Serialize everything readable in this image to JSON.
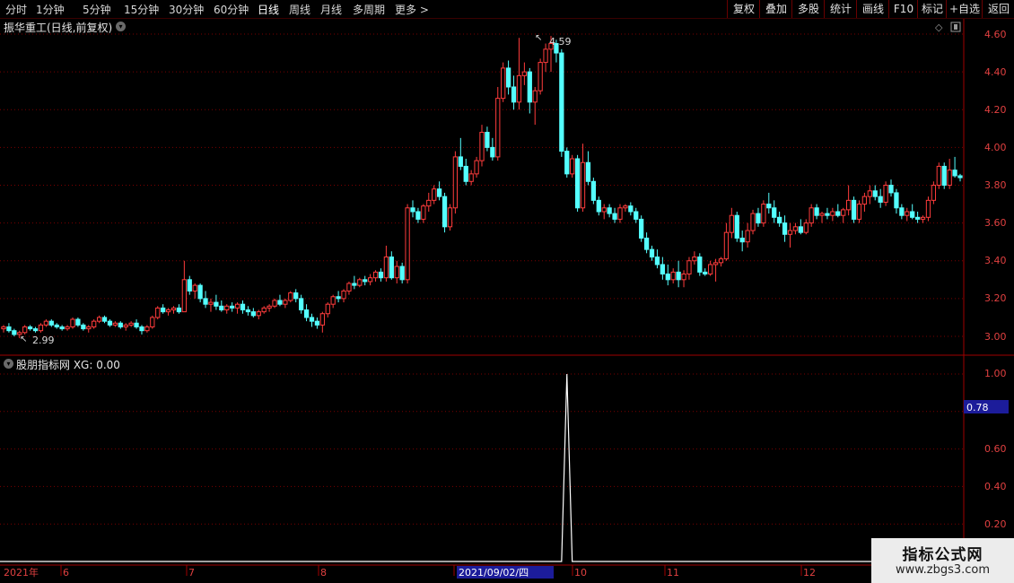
{
  "toolbar": {
    "periods": [
      "分时",
      "1分钟",
      "5分钟",
      "15分钟",
      "30分钟",
      "60分钟",
      "日线",
      "周线",
      "月线",
      "多周期",
      "更多 >"
    ],
    "active_period": "日线",
    "right_buttons": [
      "复权",
      "叠加",
      "多股",
      "统计",
      "画线",
      "F10",
      "标记",
      "+自选",
      "返回"
    ]
  },
  "main_chart": {
    "title": "振华重工(日线,前复权)",
    "price_ticks": [
      "4.60",
      "4.40",
      "4.20",
      "4.00",
      "3.80",
      "3.60",
      "3.40",
      "3.20",
      "3.00"
    ],
    "high_label": "4.59",
    "low_label": "2.99"
  },
  "indicator": {
    "title": "股朋指标网 XG: 0.00",
    "ticks": [
      "1.00",
      "0.80",
      "0.60",
      "0.40",
      "0.20"
    ],
    "cursor_value": "0.78"
  },
  "time_axis": {
    "labels": [
      "2021年",
      "6",
      "7",
      "8",
      "9",
      "10",
      "11",
      "12"
    ],
    "cursor_date": "2021/09/02/四"
  },
  "watermark": {
    "title": "指标公式网",
    "url": "www.zbgs3.com"
  },
  "colors": {
    "up": "#ff3c3c",
    "down": "#54ffff",
    "grid": "#7a0000",
    "axis": "#a00000"
  },
  "chart_data": {
    "type": "candlestick",
    "price_range": [
      2.95,
      4.65
    ],
    "indicator_name": "XG",
    "indicator_range": [
      0,
      1.06
    ],
    "indicator_values": {
      "spike_index": 106,
      "spike_value": 1.0,
      "baseline": 0.0
    },
    "candles": [
      [
        3.04,
        3.06,
        3.02,
        3.05
      ],
      [
        3.05,
        3.07,
        3.02,
        3.03
      ],
      [
        3.03,
        3.04,
        3.0,
        3.01
      ],
      [
        3.01,
        3.03,
        2.99,
        3.02
      ],
      [
        3.02,
        3.06,
        3.01,
        3.05
      ],
      [
        3.05,
        3.06,
        3.03,
        3.04
      ],
      [
        3.04,
        3.05,
        3.02,
        3.03
      ],
      [
        3.03,
        3.07,
        3.02,
        3.06
      ],
      [
        3.06,
        3.09,
        3.05,
        3.08
      ],
      [
        3.08,
        3.09,
        3.05,
        3.06
      ],
      [
        3.06,
        3.07,
        3.04,
        3.05
      ],
      [
        3.05,
        3.06,
        3.03,
        3.04
      ],
      [
        3.04,
        3.06,
        3.03,
        3.05
      ],
      [
        3.05,
        3.1,
        3.04,
        3.09
      ],
      [
        3.09,
        3.1,
        3.05,
        3.06
      ],
      [
        3.06,
        3.07,
        3.03,
        3.04
      ],
      [
        3.04,
        3.06,
        3.02,
        3.05
      ],
      [
        3.05,
        3.09,
        3.04,
        3.08
      ],
      [
        3.08,
        3.11,
        3.07,
        3.1
      ],
      [
        3.1,
        3.11,
        3.07,
        3.08
      ],
      [
        3.08,
        3.09,
        3.05,
        3.06
      ],
      [
        3.06,
        3.08,
        3.05,
        3.07
      ],
      [
        3.07,
        3.08,
        3.04,
        3.05
      ],
      [
        3.05,
        3.07,
        3.03,
        3.06
      ],
      [
        3.06,
        3.08,
        3.05,
        3.07
      ],
      [
        3.07,
        3.09,
        3.04,
        3.05
      ],
      [
        3.05,
        3.06,
        3.01,
        3.03
      ],
      [
        3.03,
        3.06,
        3.02,
        3.05
      ],
      [
        3.05,
        3.11,
        3.04,
        3.1
      ],
      [
        3.1,
        3.16,
        3.09,
        3.15
      ],
      [
        3.15,
        3.17,
        3.12,
        3.13
      ],
      [
        3.13,
        3.15,
        3.11,
        3.14
      ],
      [
        3.14,
        3.16,
        3.12,
        3.15
      ],
      [
        3.15,
        3.17,
        3.12,
        3.13
      ],
      [
        3.13,
        3.4,
        3.13,
        3.3
      ],
      [
        3.3,
        3.32,
        3.22,
        3.24
      ],
      [
        3.24,
        3.28,
        3.2,
        3.27
      ],
      [
        3.27,
        3.28,
        3.18,
        3.2
      ],
      [
        3.2,
        3.24,
        3.15,
        3.17
      ],
      [
        3.17,
        3.2,
        3.13,
        3.18
      ],
      [
        3.18,
        3.22,
        3.14,
        3.16
      ],
      [
        3.16,
        3.19,
        3.13,
        3.14
      ],
      [
        3.14,
        3.17,
        3.12,
        3.16
      ],
      [
        3.16,
        3.18,
        3.13,
        3.15
      ],
      [
        3.15,
        3.18,
        3.12,
        3.17
      ],
      [
        3.17,
        3.19,
        3.12,
        3.14
      ],
      [
        3.14,
        3.16,
        3.11,
        3.13
      ],
      [
        3.13,
        3.15,
        3.1,
        3.11
      ],
      [
        3.11,
        3.14,
        3.09,
        3.13
      ],
      [
        3.13,
        3.16,
        3.12,
        3.15
      ],
      [
        3.15,
        3.17,
        3.13,
        3.16
      ],
      [
        3.16,
        3.2,
        3.15,
        3.19
      ],
      [
        3.19,
        3.22,
        3.16,
        3.17
      ],
      [
        3.17,
        3.2,
        3.15,
        3.19
      ],
      [
        3.19,
        3.24,
        3.18,
        3.23
      ],
      [
        3.23,
        3.25,
        3.18,
        3.2
      ],
      [
        3.2,
        3.22,
        3.12,
        3.14
      ],
      [
        3.14,
        3.17,
        3.08,
        3.1
      ],
      [
        3.1,
        3.12,
        3.05,
        3.08
      ],
      [
        3.08,
        3.1,
        3.04,
        3.06
      ],
      [
        3.06,
        3.13,
        3.02,
        3.12
      ],
      [
        3.12,
        3.18,
        3.1,
        3.17
      ],
      [
        3.17,
        3.22,
        3.15,
        3.21
      ],
      [
        3.21,
        3.24,
        3.18,
        3.2
      ],
      [
        3.2,
        3.25,
        3.18,
        3.24
      ],
      [
        3.24,
        3.29,
        3.22,
        3.28
      ],
      [
        3.28,
        3.32,
        3.25,
        3.27
      ],
      [
        3.27,
        3.31,
        3.26,
        3.3
      ],
      [
        3.3,
        3.32,
        3.27,
        3.29
      ],
      [
        3.29,
        3.33,
        3.27,
        3.31
      ],
      [
        3.31,
        3.35,
        3.29,
        3.34
      ],
      [
        3.34,
        3.36,
        3.29,
        3.31
      ],
      [
        3.31,
        3.48,
        3.29,
        3.42
      ],
      [
        3.42,
        3.45,
        3.3,
        3.31
      ],
      [
        3.31,
        3.4,
        3.28,
        3.37
      ],
      [
        3.37,
        3.39,
        3.28,
        3.3
      ],
      [
        3.3,
        3.7,
        3.28,
        3.68
      ],
      [
        3.68,
        3.72,
        3.63,
        3.66
      ],
      [
        3.66,
        3.68,
        3.6,
        3.62
      ],
      [
        3.62,
        3.7,
        3.6,
        3.69
      ],
      [
        3.69,
        3.76,
        3.66,
        3.72
      ],
      [
        3.72,
        3.8,
        3.7,
        3.78
      ],
      [
        3.78,
        3.82,
        3.72,
        3.74
      ],
      [
        3.74,
        3.76,
        3.55,
        3.58
      ],
      [
        3.58,
        3.7,
        3.56,
        3.68
      ],
      [
        3.68,
        3.98,
        3.65,
        3.95
      ],
      [
        3.95,
        4.05,
        3.88,
        3.9
      ],
      [
        3.9,
        3.94,
        3.8,
        3.82
      ],
      [
        3.82,
        3.88,
        3.8,
        3.86
      ],
      [
        3.86,
        3.95,
        3.84,
        3.93
      ],
      [
        3.93,
        4.12,
        3.9,
        4.08
      ],
      [
        4.08,
        4.11,
        3.98,
        4.0
      ],
      [
        4.0,
        4.05,
        3.93,
        3.95
      ],
      [
        3.95,
        4.32,
        3.93,
        4.26
      ],
      [
        4.26,
        4.45,
        4.24,
        4.42
      ],
      [
        4.42,
        4.46,
        4.28,
        4.32
      ],
      [
        4.32,
        4.38,
        4.2,
        4.24
      ],
      [
        4.24,
        4.58,
        4.2,
        4.38
      ],
      [
        4.38,
        4.45,
        4.33,
        4.4
      ],
      [
        4.4,
        4.42,
        4.18,
        4.24
      ],
      [
        4.24,
        4.32,
        4.12,
        4.3
      ],
      [
        4.3,
        4.47,
        4.28,
        4.45
      ],
      [
        4.45,
        4.55,
        4.4,
        4.52
      ],
      [
        4.52,
        4.59,
        4.4,
        4.55
      ],
      [
        4.55,
        4.57,
        4.45,
        4.5
      ],
      [
        4.5,
        4.52,
        3.95,
        3.98
      ],
      [
        3.98,
        4.0,
        3.84,
        3.86
      ],
      [
        3.86,
        3.96,
        3.84,
        3.94
      ],
      [
        3.94,
        3.96,
        3.66,
        3.68
      ],
      [
        3.68,
        4.02,
        3.66,
        3.92
      ],
      [
        3.92,
        3.98,
        3.8,
        3.82
      ],
      [
        3.82,
        3.84,
        3.7,
        3.72
      ],
      [
        3.72,
        3.74,
        3.64,
        3.66
      ],
      [
        3.66,
        3.7,
        3.62,
        3.68
      ],
      [
        3.68,
        3.7,
        3.63,
        3.65
      ],
      [
        3.65,
        3.68,
        3.6,
        3.62
      ],
      [
        3.62,
        3.7,
        3.6,
        3.68
      ],
      [
        3.68,
        3.7,
        3.66,
        3.69
      ],
      [
        3.69,
        3.71,
        3.64,
        3.66
      ],
      [
        3.66,
        3.68,
        3.6,
        3.62
      ],
      [
        3.62,
        3.64,
        3.5,
        3.52
      ],
      [
        3.52,
        3.55,
        3.44,
        3.46
      ],
      [
        3.46,
        3.48,
        3.4,
        3.42
      ],
      [
        3.42,
        3.46,
        3.36,
        3.38
      ],
      [
        3.38,
        3.42,
        3.3,
        3.33
      ],
      [
        3.33,
        3.38,
        3.27,
        3.3
      ],
      [
        3.3,
        3.36,
        3.28,
        3.34
      ],
      [
        3.34,
        3.4,
        3.26,
        3.3
      ],
      [
        3.3,
        3.35,
        3.26,
        3.33
      ],
      [
        3.33,
        3.42,
        3.3,
        3.4
      ],
      [
        3.4,
        3.45,
        3.38,
        3.42
      ],
      [
        3.42,
        3.44,
        3.32,
        3.34
      ],
      [
        3.34,
        3.36,
        3.32,
        3.33
      ],
      [
        3.33,
        3.4,
        3.32,
        3.38
      ],
      [
        3.38,
        3.41,
        3.29,
        3.39
      ],
      [
        3.39,
        3.42,
        3.37,
        3.41
      ],
      [
        3.41,
        3.6,
        3.4,
        3.55
      ],
      [
        3.55,
        3.68,
        3.52,
        3.64
      ],
      [
        3.64,
        3.66,
        3.5,
        3.52
      ],
      [
        3.52,
        3.56,
        3.45,
        3.5
      ],
      [
        3.5,
        3.6,
        3.47,
        3.56
      ],
      [
        3.56,
        3.67,
        3.54,
        3.65
      ],
      [
        3.65,
        3.68,
        3.58,
        3.6
      ],
      [
        3.6,
        3.72,
        3.58,
        3.7
      ],
      [
        3.7,
        3.76,
        3.65,
        3.68
      ],
      [
        3.68,
        3.72,
        3.6,
        3.63
      ],
      [
        3.63,
        3.66,
        3.58,
        3.6
      ],
      [
        3.6,
        3.64,
        3.5,
        3.54
      ],
      [
        3.54,
        3.6,
        3.47,
        3.56
      ],
      [
        3.56,
        3.6,
        3.54,
        3.58
      ],
      [
        3.58,
        3.62,
        3.54,
        3.55
      ],
      [
        3.55,
        3.62,
        3.54,
        3.6
      ],
      [
        3.6,
        3.7,
        3.58,
        3.68
      ],
      [
        3.68,
        3.7,
        3.62,
        3.64
      ],
      [
        3.64,
        3.66,
        3.6,
        3.65
      ],
      [
        3.65,
        3.68,
        3.62,
        3.64
      ],
      [
        3.64,
        3.68,
        3.61,
        3.66
      ],
      [
        3.66,
        3.7,
        3.63,
        3.64
      ],
      [
        3.64,
        3.68,
        3.6,
        3.67
      ],
      [
        3.67,
        3.8,
        3.64,
        3.72
      ],
      [
        3.72,
        3.74,
        3.6,
        3.62
      ],
      [
        3.62,
        3.72,
        3.6,
        3.7
      ],
      [
        3.7,
        3.76,
        3.66,
        3.74
      ],
      [
        3.74,
        3.8,
        3.7,
        3.77
      ],
      [
        3.77,
        3.8,
        3.72,
        3.74
      ],
      [
        3.74,
        3.78,
        3.68,
        3.71
      ],
      [
        3.71,
        3.82,
        3.69,
        3.8
      ],
      [
        3.8,
        3.83,
        3.74,
        3.76
      ],
      [
        3.76,
        3.78,
        3.65,
        3.68
      ],
      [
        3.68,
        3.7,
        3.62,
        3.64
      ],
      [
        3.64,
        3.68,
        3.61,
        3.66
      ],
      [
        3.66,
        3.7,
        3.62,
        3.63
      ],
      [
        3.63,
        3.66,
        3.6,
        3.62
      ],
      [
        3.62,
        3.64,
        3.6,
        3.63
      ],
      [
        3.63,
        3.74,
        3.61,
        3.72
      ],
      [
        3.72,
        3.82,
        3.7,
        3.8
      ],
      [
        3.8,
        3.92,
        3.78,
        3.9
      ],
      [
        3.9,
        3.92,
        3.78,
        3.8
      ],
      [
        3.8,
        3.94,
        3.78,
        3.88
      ],
      [
        3.88,
        3.95,
        3.84,
        3.85
      ],
      [
        3.85,
        3.86,
        3.82,
        3.84
      ]
    ]
  }
}
